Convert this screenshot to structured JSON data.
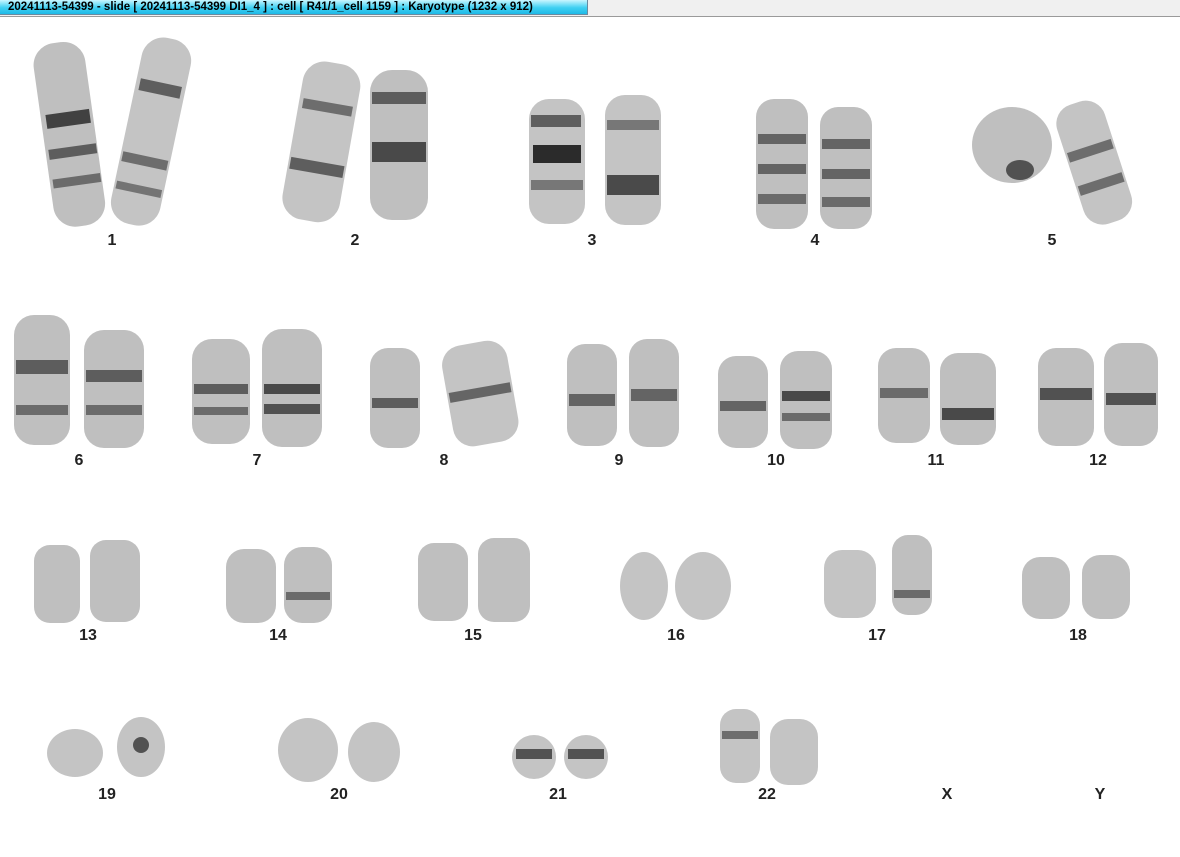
{
  "window": {
    "title": "20241113-54399 - slide [ 20241113-54399 DI1_4 ] : cell [ R41/1_cell 1159 ] : Karyotype  (1232 x 912)"
  },
  "karyotype": {
    "ink": "#3a3a3a",
    "labels": {
      "c1": "1",
      "c2": "2",
      "c3": "3",
      "c4": "4",
      "c5": "5",
      "c6": "6",
      "c7": "7",
      "c8": "8",
      "c9": "9",
      "c10": "10",
      "c11": "11",
      "c12": "12",
      "c13": "13",
      "c14": "14",
      "c15": "15",
      "c16": "16",
      "c17": "17",
      "c18": "18",
      "c19": "19",
      "c20": "20",
      "c21": "21",
      "c22": "22",
      "cX": "X",
      "cY": "Y"
    }
  }
}
